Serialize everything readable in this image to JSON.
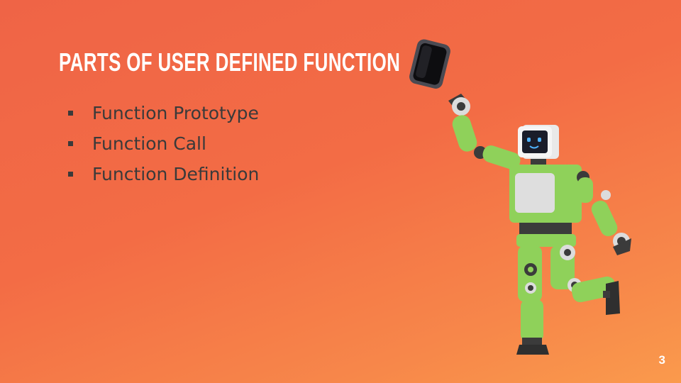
{
  "slide": {
    "title": "Parts of User Defined Function",
    "bullets": [
      {
        "label": "Function Prototype"
      },
      {
        "label": "Function Call"
      },
      {
        "label": "Function Definition"
      }
    ],
    "slide_number": "3"
  },
  "illustration": {
    "icon": "robot-holding-phone-icon",
    "colors": {
      "robot_body": "#8fd15a",
      "joints": "#3b3b3b",
      "screen": "#1a1d2a",
      "eyes": "#4fb3ff"
    }
  },
  "theme": {
    "background_start": "#ef6446",
    "background_end": "#fa9a4c",
    "title_color": "#ffffff",
    "text_color": "#3a3a3a"
  }
}
